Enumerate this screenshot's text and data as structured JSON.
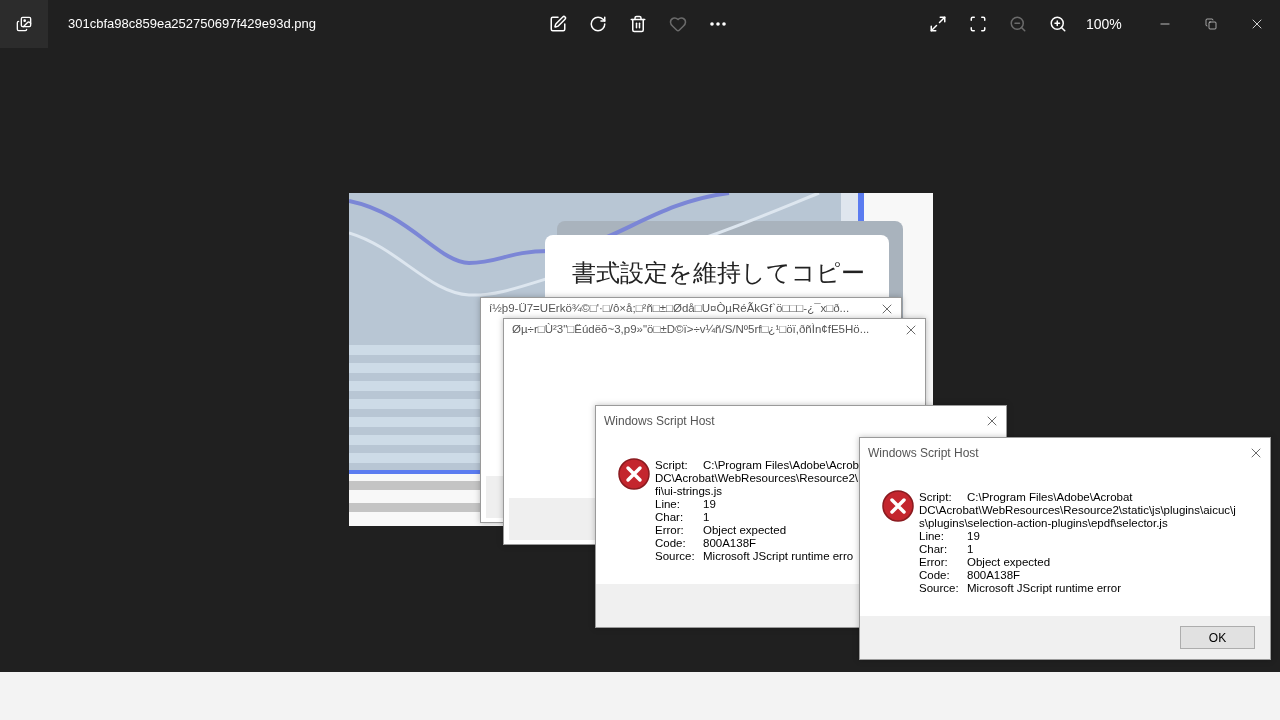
{
  "window": {
    "title": "301cbfa98c859ea252750697f429e93d.png"
  },
  "zoom_out": {
    "disabled": true
  },
  "zoom_level": "100%",
  "image": {
    "heading": "書式設定を維持してコピー"
  },
  "dialogs": [
    {
      "kind": "blank",
      "title": "í½þ9-Ü7=UErkö¾©□'·□/ô×å;□²ñ□±□Ødå□U¤ÒµRéÃkGf`ö□□□-¿¯x□ð..."
    },
    {
      "kind": "blank",
      "title": "Øµ÷r□Ù²3\"□Ëúdëõ~3,p9»\"ö□±D©ï>÷v¼ñ/S/Nº5rf□¿¹□öï,ðñÌn¢fE5Hö..."
    },
    {
      "kind": "error",
      "title": "Windows Script Host",
      "script_label": "Script:",
      "script_lines": [
        "C:\\Program Files\\Adobe\\Acrob",
        "DC\\Acrobat\\WebResources\\Resource2\\",
        "fi\\ui-strings.js"
      ],
      "fields": [
        {
          "label": "Line:",
          "value": "19"
        },
        {
          "label": "Char:",
          "value": "1"
        },
        {
          "label": "Error:",
          "value": "Object expected"
        },
        {
          "label": "Code:",
          "value": "800A138F"
        },
        {
          "label": "Source:",
          "value": "Microsoft JScript runtime erro"
        }
      ]
    },
    {
      "kind": "error",
      "title": "Windows Script Host",
      "script_label": "Script:",
      "script_lines": [
        "C:\\Program Files\\Adobe\\Acrobat",
        "DC\\Acrobat\\WebResources\\Resource2\\static\\js\\plugins\\aicuc\\j",
        "s\\plugins\\selection-action-plugins\\epdf\\selector.js"
      ],
      "fields": [
        {
          "label": "Line:",
          "value": "19"
        },
        {
          "label": "Char:",
          "value": "1"
        },
        {
          "label": "Error:",
          "value": "Object expected"
        },
        {
          "label": "Code:",
          "value": "800A138F"
        },
        {
          "label": "Source:",
          "value": "Microsoft JScript runtime error"
        }
      ],
      "button": "OK"
    }
  ]
}
